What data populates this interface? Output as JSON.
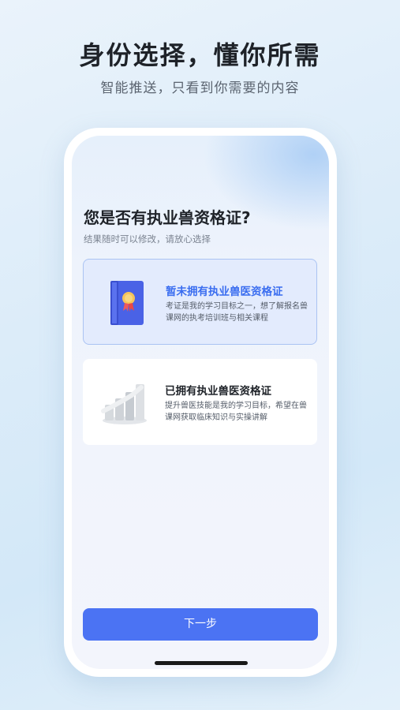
{
  "hero": {
    "title": "身份选择，懂你所需",
    "subtitle": "智能推送，只看到你需要的内容"
  },
  "question": {
    "title": "您是否有执业兽资格证?",
    "hint": "结果随时可以修改，请放心选择"
  },
  "options": [
    {
      "title": "暂未拥有执业兽医资格证",
      "desc": "考证是我的学习目标之一，想了解报名兽课网的执考培训班与相关课程",
      "selected": true,
      "icon": "certificate-book-icon"
    },
    {
      "title": "已拥有执业兽医资格证",
      "desc": "提升兽医技能是我的学习目标，希望在兽课网获取临床知识与实操讲解",
      "selected": false,
      "icon": "growth-bars-icon"
    }
  ],
  "next_button": {
    "label": "下一步"
  },
  "colors": {
    "accent": "#4b73f3",
    "selected_bg": "#e3ebfd",
    "selected_title": "#3a6df0"
  }
}
